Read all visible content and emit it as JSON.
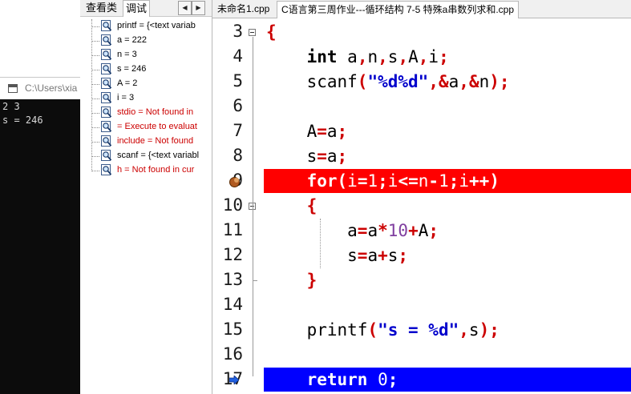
{
  "console": {
    "title": "C:\\Users\\xia",
    "output_lines": [
      "2 3",
      "s = 246"
    ]
  },
  "panel": {
    "tabs": [
      "查看类",
      "调试"
    ],
    "active_tab": "调试",
    "watches": [
      {
        "text": "printf = {<text variab",
        "error": false
      },
      {
        "text": "a = 222",
        "error": false
      },
      {
        "text": "n = 3",
        "error": false
      },
      {
        "text": "s = 246",
        "error": false
      },
      {
        "text": "A = 2",
        "error": false
      },
      {
        "text": "i = 3",
        "error": false
      },
      {
        "text": "stdio = Not found in",
        "error": true
      },
      {
        "text": " = Execute to evaluat",
        "error": true
      },
      {
        "text": "include = Not found",
        "error": true
      },
      {
        "text": "scanf = {<text variabl",
        "error": false
      },
      {
        "text": "h = Not found in cur",
        "error": true
      }
    ]
  },
  "editor": {
    "tabs": [
      "未命名1.cpp",
      "C语言第三周作业---循环结构 7-5 特殊a串数列求和.cpp"
    ],
    "active_tab": 1,
    "breakpoint_line": 9,
    "current_line": 17,
    "lines": [
      {
        "n": "3",
        "tokens": [
          [
            "op",
            "{"
          ]
        ]
      },
      {
        "n": "4",
        "tokens": [
          [
            "pl",
            "    "
          ],
          [
            "kw",
            "int"
          ],
          [
            "pl",
            " a"
          ],
          [
            "op",
            ","
          ],
          [
            "pl",
            "n"
          ],
          [
            "op",
            ","
          ],
          [
            "pl",
            "s"
          ],
          [
            "op",
            ","
          ],
          [
            "pl",
            "A"
          ],
          [
            "op",
            ","
          ],
          [
            "pl",
            "i"
          ],
          [
            "op",
            ";"
          ]
        ]
      },
      {
        "n": "5",
        "tokens": [
          [
            "pl",
            "    scanf"
          ],
          [
            "op",
            "("
          ],
          [
            "str",
            "\"%d%d\""
          ],
          [
            "op",
            ","
          ],
          [
            "op",
            "&"
          ],
          [
            "pl",
            "a"
          ],
          [
            "op",
            ","
          ],
          [
            "op",
            "&"
          ],
          [
            "pl",
            "n"
          ],
          [
            "op",
            ")"
          ],
          [
            "op",
            ";"
          ]
        ]
      },
      {
        "n": "6",
        "tokens": []
      },
      {
        "n": "7",
        "tokens": [
          [
            "pl",
            "    A"
          ],
          [
            "op",
            "="
          ],
          [
            "pl",
            "a"
          ],
          [
            "op",
            ";"
          ]
        ]
      },
      {
        "n": "8",
        "tokens": [
          [
            "pl",
            "    s"
          ],
          [
            "op",
            "="
          ],
          [
            "pl",
            "a"
          ],
          [
            "op",
            ";"
          ]
        ]
      },
      {
        "n": "9",
        "tokens": [
          [
            "pl",
            "    "
          ],
          [
            "kw",
            "for"
          ],
          [
            "op",
            "("
          ],
          [
            "pl",
            "i"
          ],
          [
            "op",
            "="
          ],
          [
            "num",
            "1"
          ],
          [
            "op",
            ";"
          ],
          [
            "pl",
            "i"
          ],
          [
            "op",
            "<="
          ],
          [
            "pl",
            "n"
          ],
          [
            "op",
            "-"
          ],
          [
            "num",
            "1"
          ],
          [
            "op",
            ";"
          ],
          [
            "pl",
            "i"
          ],
          [
            "op",
            "++"
          ],
          [
            "op",
            ")"
          ]
        ]
      },
      {
        "n": "10",
        "tokens": [
          [
            "pl",
            "    "
          ],
          [
            "op",
            "{"
          ]
        ]
      },
      {
        "n": "11",
        "tokens": [
          [
            "pl",
            "        a"
          ],
          [
            "op",
            "="
          ],
          [
            "pl",
            "a"
          ],
          [
            "op",
            "*"
          ],
          [
            "num",
            "10"
          ],
          [
            "op",
            "+"
          ],
          [
            "pl",
            "A"
          ],
          [
            "op",
            ";"
          ]
        ]
      },
      {
        "n": "12",
        "tokens": [
          [
            "pl",
            "        s"
          ],
          [
            "op",
            "="
          ],
          [
            "pl",
            "a"
          ],
          [
            "op",
            "+"
          ],
          [
            "pl",
            "s"
          ],
          [
            "op",
            ";"
          ]
        ]
      },
      {
        "n": "13",
        "tokens": [
          [
            "pl",
            "    "
          ],
          [
            "op",
            "}"
          ]
        ]
      },
      {
        "n": "14",
        "tokens": []
      },
      {
        "n": "15",
        "tokens": [
          [
            "pl",
            "    printf"
          ],
          [
            "op",
            "("
          ],
          [
            "str",
            "\"s = %d\""
          ],
          [
            "op",
            ","
          ],
          [
            "pl",
            "s"
          ],
          [
            "op",
            ")"
          ],
          [
            "op",
            ";"
          ]
        ]
      },
      {
        "n": "16",
        "tokens": []
      },
      {
        "n": "17",
        "tokens": [
          [
            "pl",
            "    "
          ],
          [
            "kw",
            "return"
          ],
          [
            "pl",
            " "
          ],
          [
            "num",
            "0"
          ],
          [
            "op",
            ";"
          ]
        ]
      }
    ]
  },
  "colors": {
    "breakpoint_bg": "#ff0000",
    "current_line_bg": "#0000ff",
    "operator": "#cc0000",
    "string": "#0000cc",
    "number": "#8040a0"
  },
  "icons": {
    "watch_item": "magnifier-watch-icon",
    "breakpoint": "breakpoint-dot-icon",
    "exec_pointer": "execution-arrow-icon",
    "fold": "fold-minus-icon"
  }
}
